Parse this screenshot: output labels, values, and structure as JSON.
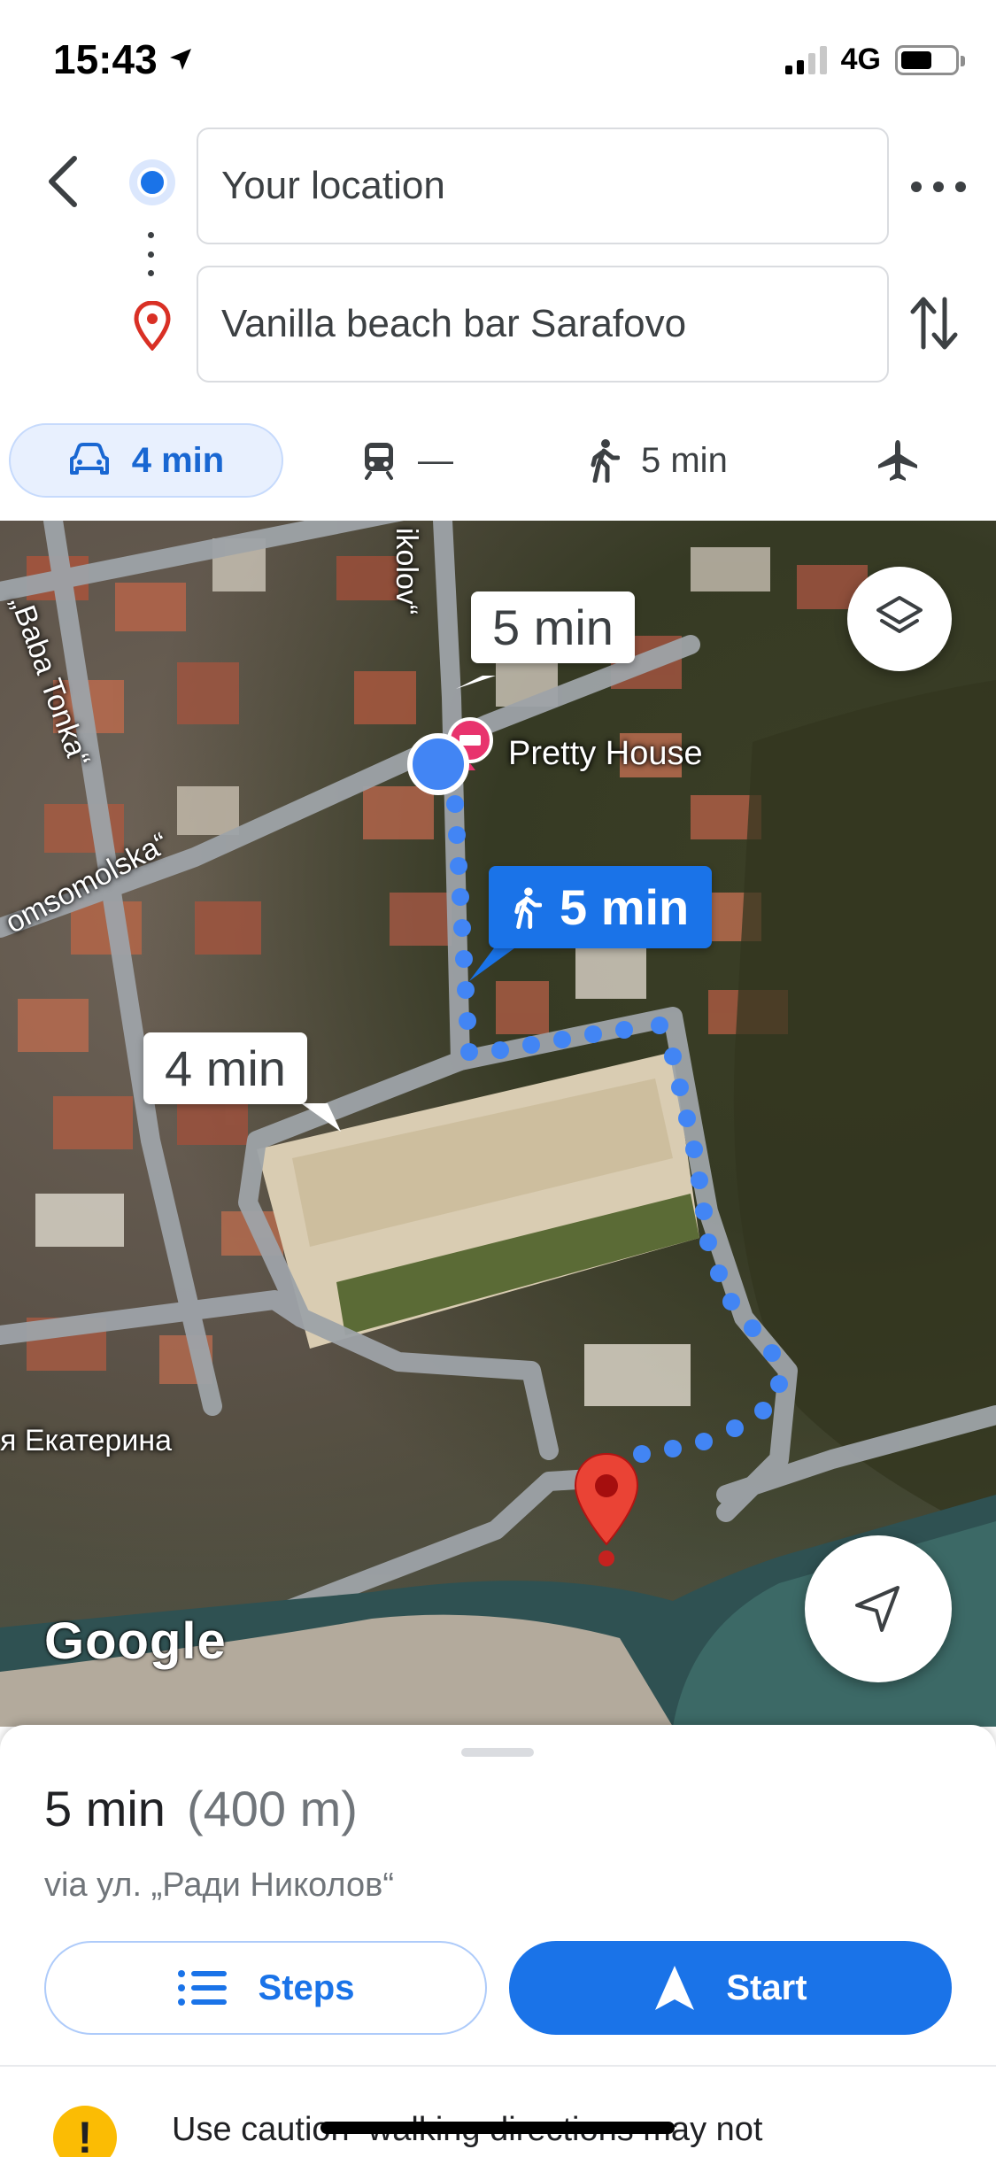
{
  "status_bar": {
    "time": "15:43",
    "network": "4G",
    "icons": [
      "location-arrow-icon",
      "signal-icon",
      "battery-icon"
    ]
  },
  "route": {
    "origin": "Your location",
    "destination": "Vanilla beach bar Sarafovo"
  },
  "modes": [
    {
      "name": "drive",
      "icon": "car-icon",
      "label": "4 min",
      "selected": true
    },
    {
      "name": "transit",
      "icon": "train-icon",
      "label": "—",
      "selected": false
    },
    {
      "name": "walk",
      "icon": "walk-icon",
      "label": "5 min",
      "selected": false
    },
    {
      "name": "flight",
      "icon": "airplane-icon",
      "label": "",
      "selected": false
    }
  ],
  "map": {
    "callouts": {
      "alt_route": "5 min",
      "walk_route": "5 min",
      "drive_route": "4 min"
    },
    "poi": "Pretty House",
    "streets": {
      "top": "ikolov“",
      "left_top": "„Baba Tonka“",
      "left_mid": "omsomolska“",
      "bottom": "я Екатерина"
    },
    "attribution": "Google",
    "route_color": "#4285f4",
    "dest_color": "#ea4335"
  },
  "summary": {
    "duration": "5 min",
    "distance": "(400 m)",
    "via": "via ул. „Ради Николов“"
  },
  "actions": {
    "steps": "Steps",
    "start": "Start"
  },
  "warning": {
    "text": "Use caution–walking directions may not"
  },
  "colors": {
    "accent": "#1a73e8",
    "warning": "#fbbc04"
  }
}
